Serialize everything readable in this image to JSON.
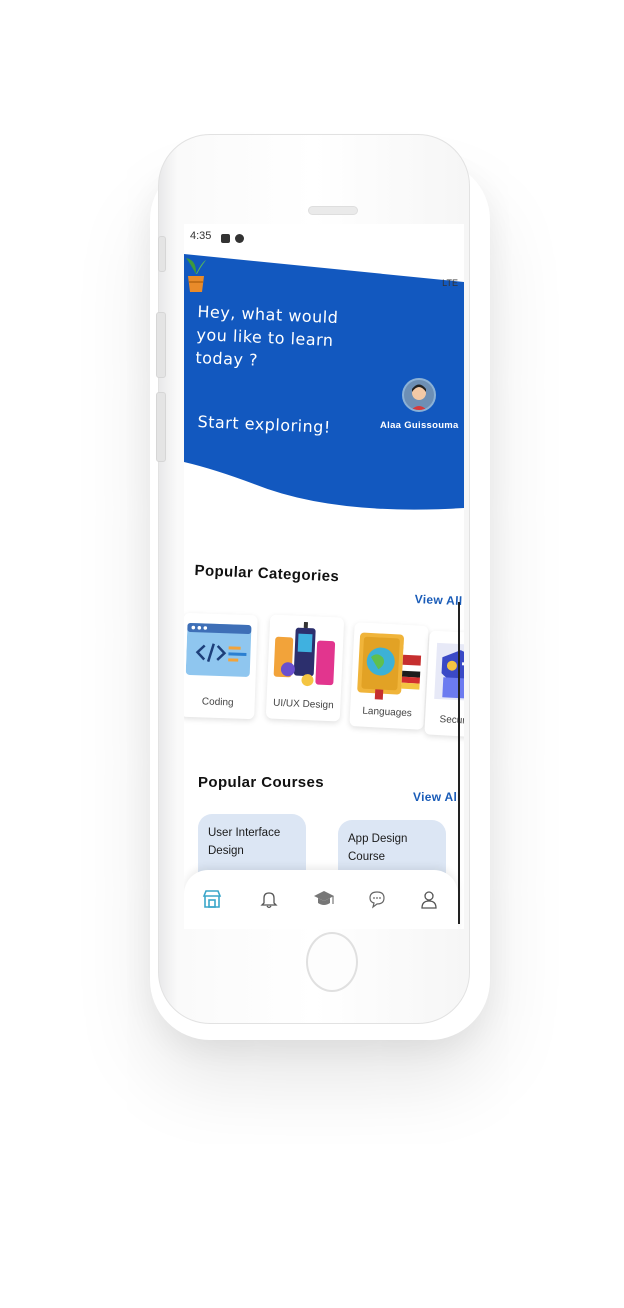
{
  "status_bar": {
    "time": "4:35",
    "network": "LTE"
  },
  "hero": {
    "greeting_lines": [
      "Hey, what would",
      "you like to learn",
      "today ?"
    ],
    "subtitle": "Start exploring!",
    "user_name": "Alaa Guissouma",
    "background_color": "#1258bf"
  },
  "categories": {
    "title": "Popular Categories",
    "view_all": "View All",
    "items": [
      {
        "label": "Coding",
        "icon": "code-window-icon"
      },
      {
        "label": "UI/UX Design",
        "icon": "phone-mockup-icon"
      },
      {
        "label": "Languages",
        "icon": "globe-book-icon"
      },
      {
        "label": "Securit",
        "icon": "security-illustration-icon"
      }
    ]
  },
  "courses": {
    "title": "Popular Courses",
    "view_all": "View All",
    "items": [
      {
        "title": "User Interface Design"
      },
      {
        "title": "App Design Course"
      }
    ]
  },
  "bottom_nav": [
    {
      "name": "home",
      "icon": "store-icon",
      "active": true
    },
    {
      "name": "notifications",
      "icon": "bell-icon",
      "active": false
    },
    {
      "name": "courses",
      "icon": "graduation-cap-icon",
      "active": false
    },
    {
      "name": "messages",
      "icon": "chat-bubble-icon",
      "active": false
    },
    {
      "name": "profile",
      "icon": "user-icon",
      "active": false
    }
  ],
  "colors": {
    "accent": "#1a5cb8",
    "active_nav": "#3aa6c9",
    "card_bg": "#dce6f4"
  }
}
